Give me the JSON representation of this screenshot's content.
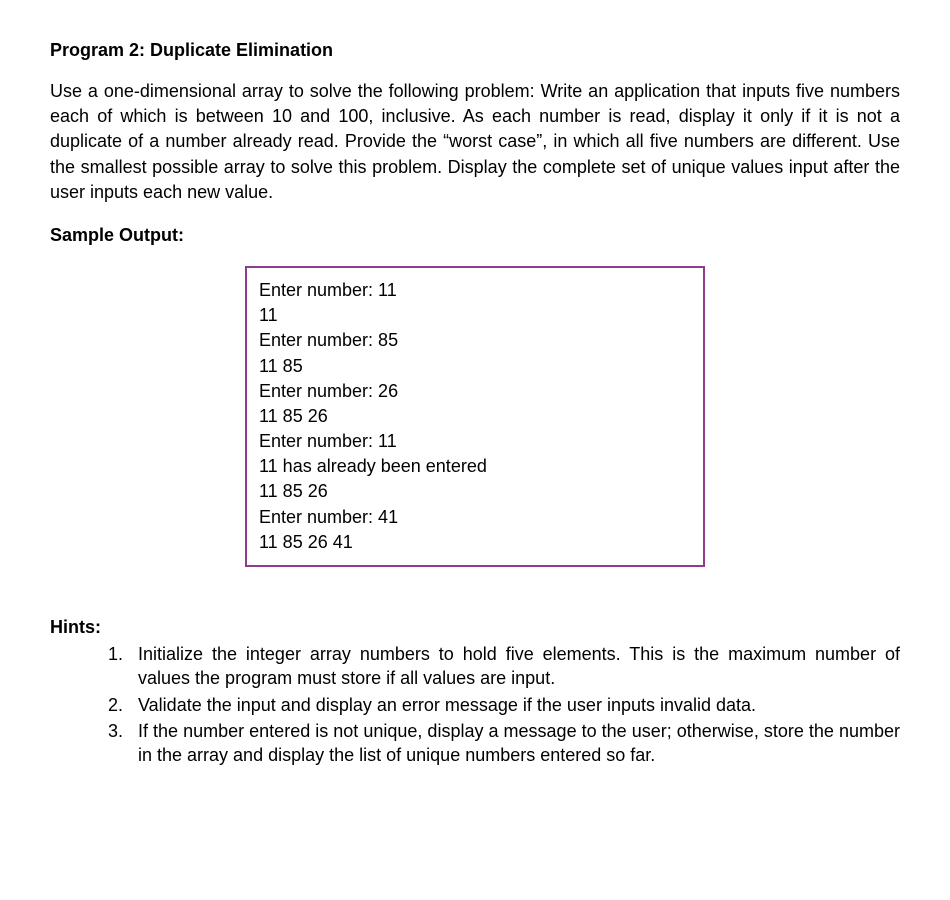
{
  "title": "Program 2: Duplicate Elimination",
  "description": "Use a one-dimensional array to solve the following problem: Write an application that inputs five numbers each of which is between 10 and 100, inclusive. As each number is read, display it only if it is not a duplicate of a number already read. Provide the “worst case”, in which all five numbers are different. Use the smallest possible array to solve this problem. Display the complete set of unique values input after the user inputs each new value.",
  "sample_output_label": "Sample Output:",
  "sample_output_lines": [
    "Enter number: 11",
    "11",
    "Enter number: 85",
    "11 85",
    "Enter number: 26",
    "11 85 26",
    "Enter number: 11",
    "11 has already been entered",
    "11 85 26",
    "Enter number: 41",
    "11 85 26 41"
  ],
  "hints_label": "Hints:",
  "hints": [
    "Initialize the integer array numbers to hold five elements. This is the maximum number of values the program must store if all values are input.",
    "Validate the input and display an error message if the user inputs invalid data.",
    "If the number entered is not unique, display a message to the user; otherwise, store the number in the array and display the list of unique numbers entered so far."
  ]
}
